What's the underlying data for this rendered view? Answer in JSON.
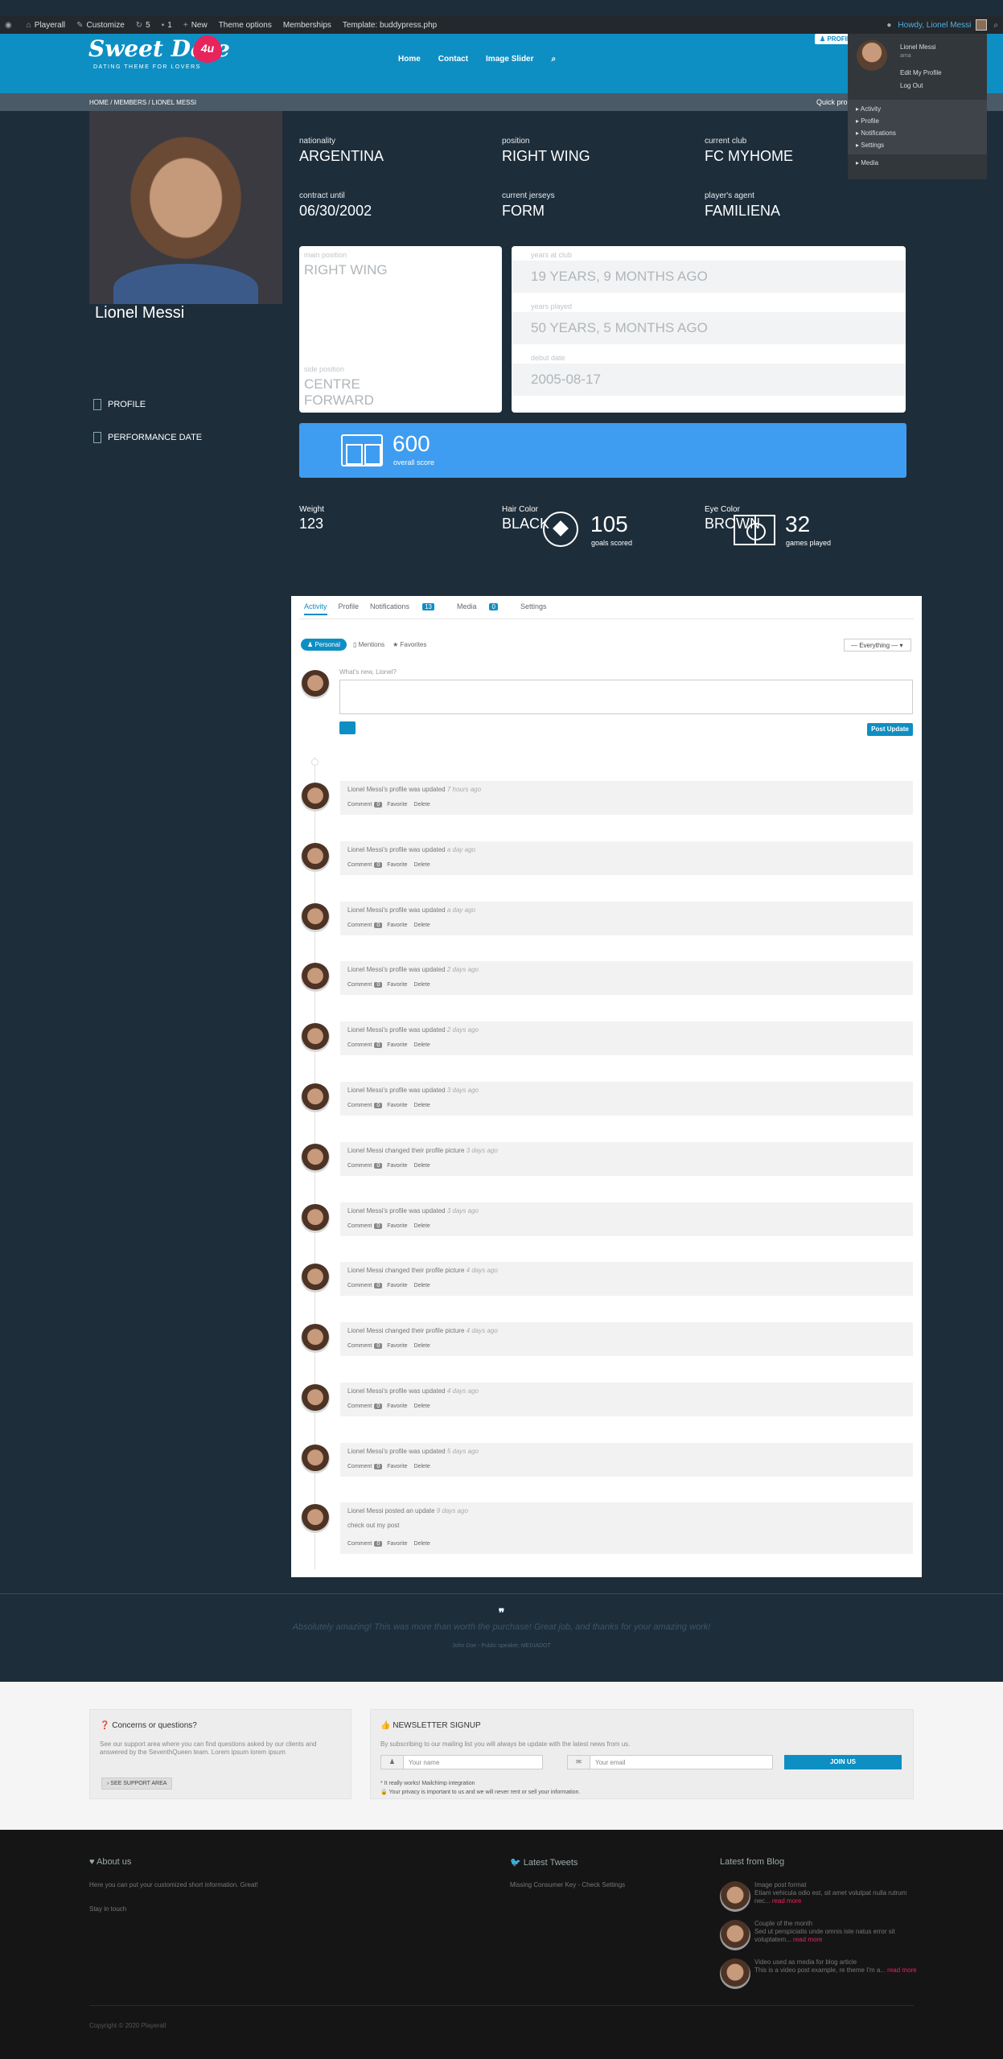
{
  "adminbar": {
    "site": "Playerall",
    "customize": "Customize",
    "updates": "5",
    "comments": "1",
    "new": "New",
    "theme_options": "Theme options",
    "memberships": "Memberships",
    "template": "Template: buddypress.php",
    "howdy": "Howdy, Lionel Messi"
  },
  "user_menu": {
    "name": "Lionel Messi",
    "handle": "ama",
    "edit_profile": "Edit My Profile",
    "logout": "Log Out",
    "items": [
      "Activity",
      "Profile",
      "Notifications",
      "Settings"
    ],
    "media": "Media"
  },
  "header": {
    "logo_text": "Sweet Date",
    "logo_badge": "4u",
    "tagline": "DATING THEME FOR LOVERS",
    "nav": [
      "Home",
      "Contact",
      "Image Slider"
    ],
    "profile_button": "PROFILE"
  },
  "breadcrumb": {
    "path": "HOME  /  MEMBERS  /  LIONEL MESSI",
    "quick": "Quick pro"
  },
  "profile": {
    "name": "Lionel Messi",
    "side_links": [
      "PROFILE",
      "PERFORMANCE DATE"
    ],
    "facts": [
      {
        "label": "nationality",
        "value": "ARGENTINA"
      },
      {
        "label": "position",
        "value": "RIGHT WING"
      },
      {
        "label": "current club",
        "value": "FC MYHOME"
      },
      {
        "label": "contract until",
        "value": "06/30/2002"
      },
      {
        "label": "current jerseys",
        "value": "FORM"
      },
      {
        "label": "player's agent",
        "value": "FAMILIENA"
      }
    ],
    "main_position_label": "main position",
    "main_position": "RIGHT WING",
    "side_position_label": "side position",
    "side_position": "CENTRE FORWARD",
    "years_at_club_label": "years at club",
    "years_at_club": "19 YEARS, 9 MONTHS AGO",
    "years_played_label": "years played",
    "years_played": "50 YEARS, 5 MONTHS AGO",
    "debut_label": "debut date",
    "debut": "2005-08-17",
    "overall_score": "600",
    "overall_label": "overall score",
    "weight_label": "Weight",
    "weight": "123",
    "hair_label": "Hair Color",
    "hair": "BLACK",
    "eye_label": "Eye Color",
    "eye": "BROWN",
    "goals": "105",
    "goals_label": "goals scored",
    "games": "32",
    "games_label": "games played"
  },
  "activity": {
    "tabs": [
      {
        "label": "Activity"
      },
      {
        "label": "Profile"
      },
      {
        "label": "Notifications",
        "count": "13"
      },
      {
        "label": "Media",
        "count": "0"
      },
      {
        "label": "Settings"
      }
    ],
    "filter_personal": "Personal",
    "filter_mentions": "Mentions",
    "filter_favorites": "Favorites",
    "select": "— Everything —",
    "whats_new": "What's new, Lionel?",
    "post_button": "Post Update",
    "comment": "Comment",
    "favorite": "Favorite",
    "delete": "Delete",
    "items": [
      {
        "text": "Lionel Messi's profile was updated",
        "time": "7 hours ago",
        "count": "0"
      },
      {
        "text": "Lionel Messi's profile was updated",
        "time": "a day ago",
        "count": "0"
      },
      {
        "text": "Lionel Messi's profile was updated",
        "time": "a day ago",
        "count": "0"
      },
      {
        "text": "Lionel Messi's profile was updated",
        "time": "2 days ago",
        "count": "0"
      },
      {
        "text": "Lionel Messi's profile was updated",
        "time": "2 days ago",
        "count": "0"
      },
      {
        "text": "Lionel Messi's profile was updated",
        "time": "3 days ago",
        "count": "0"
      },
      {
        "text": "Lionel Messi changed their profile picture",
        "time": "3 days ago",
        "count": "0"
      },
      {
        "text": "Lionel Messi's profile was updated",
        "time": "3 days ago",
        "count": "0"
      },
      {
        "text": "Lionel Messi changed their profile picture",
        "time": "4 days ago",
        "count": "0"
      },
      {
        "text": "Lionel Messi changed their profile picture",
        "time": "4 days ago",
        "count": "0"
      },
      {
        "text": "Lionel Messi's profile was updated",
        "time": "4 days ago",
        "count": "0"
      },
      {
        "text": "Lionel Messi's profile was updated",
        "time": "5 days ago",
        "count": "0"
      }
    ],
    "last_item": {
      "text": "Lionel Messi posted an update",
      "time": "9 days ago",
      "body": "check out my post",
      "count": "0"
    }
  },
  "testimonial": {
    "quote_mark": "❞",
    "text": "Absolutely amazing! This was more than worth the purchase! Great job, and thanks for your amazing work!",
    "by": "John Doe - Public speaker, MEDIADOT"
  },
  "concerns": {
    "title": "Concerns or questions?",
    "text": "See our support area where you can find questions asked by our clients and answered by the SeventhQueen team. Lorem ipsum lorem ipsum",
    "button": "› SEE SUPPORT AREA"
  },
  "newsletter": {
    "title": "NEWSLETTER SIGNUP",
    "text": "By subscribing to our mailing list you will always be update with the latest news from us.",
    "name_placeholder": "Your name",
    "email_placeholder": "Your email",
    "join": "JOIN US",
    "note1": "* It really works! Mailchimp integration",
    "note2": "🔒 Your privacy is important to us and we will never rent or sell your information."
  },
  "footer": {
    "about_title": "About us",
    "about_text": "Here you can put your customized short information. Great!",
    "stay": "Stay in touch",
    "tweets_title": "Latest Tweets",
    "tweets_text": "Missing Consumer Key - Check Settings",
    "blog_title": "Latest from Blog",
    "blog": [
      {
        "title": "Image post format",
        "text": "Etiam vehicula odio est, sit amet volutpat nulla rutrum nec...",
        "more": "read more"
      },
      {
        "title": "Couple of the month",
        "text": "Sed ut perspiciatis unde omnis iste natus error sit voluptatem...",
        "more": "read more"
      },
      {
        "title": "Video used as media for blog article",
        "text": "This is a video post example, re theme I'm a...",
        "more": "read more"
      }
    ],
    "copyright": "Copyright © 2020 Playerall"
  }
}
